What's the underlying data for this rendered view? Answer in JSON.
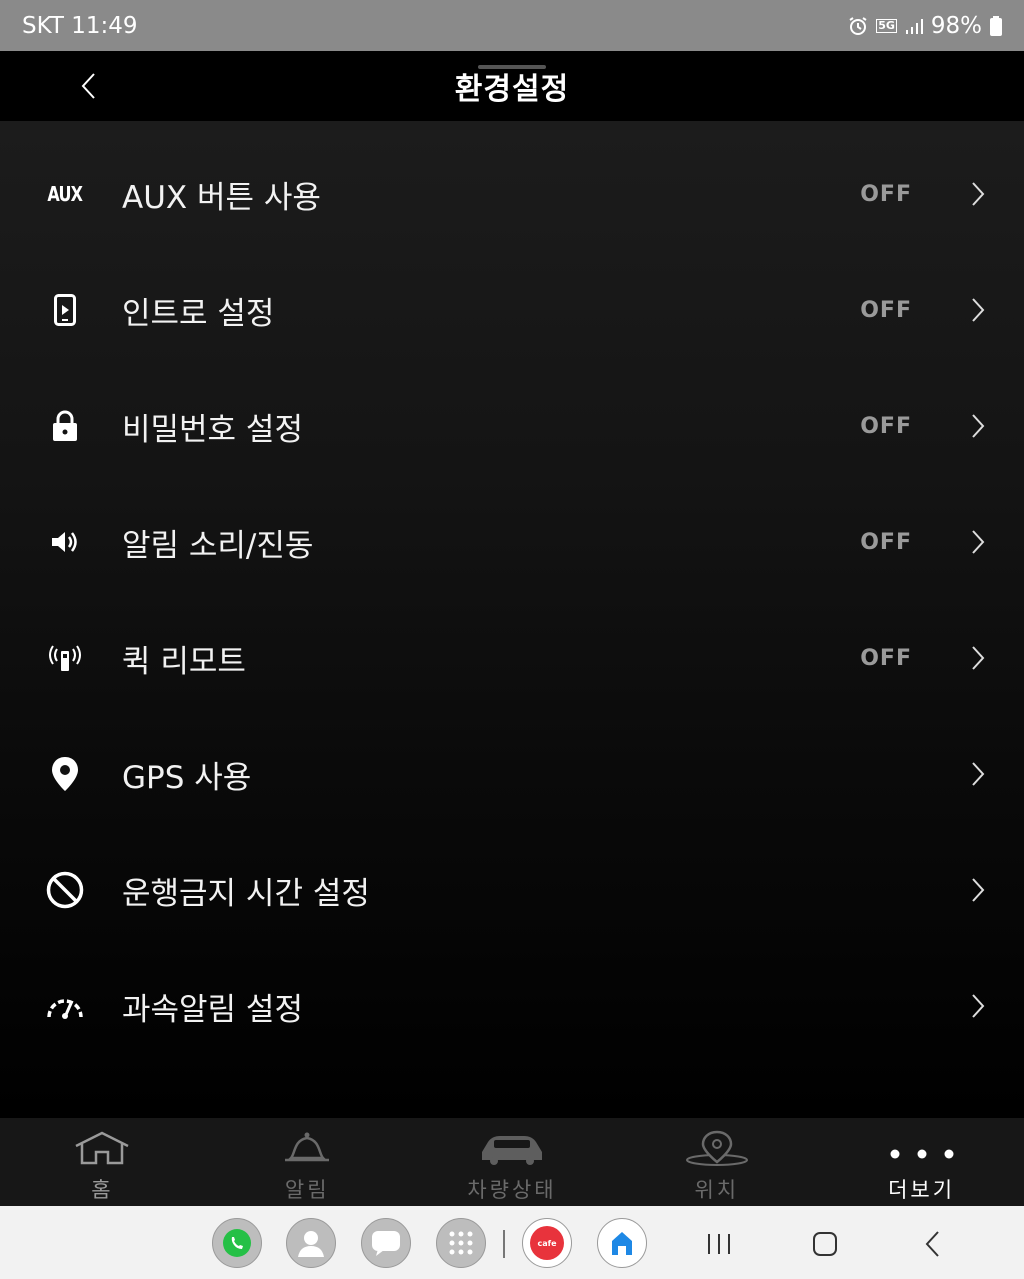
{
  "status_bar": {
    "carrier_time": "SKT 11:49",
    "network": "5G",
    "battery": "98%"
  },
  "header": {
    "title": "환경설정"
  },
  "settings": [
    {
      "icon": "aux-icon",
      "icon_text": "AUX",
      "label": "AUX 버튼 사용",
      "value": "OFF"
    },
    {
      "icon": "phone-intro-icon",
      "label": "인트로 설정",
      "value": "OFF"
    },
    {
      "icon": "lock-icon",
      "label": "비밀번호 설정",
      "value": "OFF"
    },
    {
      "icon": "speaker-icon",
      "label": "알림 소리/진동",
      "value": "OFF"
    },
    {
      "icon": "remote-signal-icon",
      "label": "퀵 리모트",
      "value": "OFF"
    },
    {
      "icon": "location-pin-icon",
      "label": "GPS 사용",
      "value": ""
    },
    {
      "icon": "prohibited-icon",
      "label": "운행금지 시간 설정",
      "value": ""
    },
    {
      "icon": "speedometer-icon",
      "label": "과속알림 설정",
      "value": ""
    }
  ],
  "tabs": [
    {
      "icon": "home-icon",
      "label": "홈",
      "active": false
    },
    {
      "icon": "bell-icon",
      "label": "알림",
      "active": false
    },
    {
      "icon": "car-icon",
      "label": "차량상태",
      "active": false
    },
    {
      "icon": "map-pin-icon",
      "label": "위치",
      "active": false
    },
    {
      "icon": "more-icon",
      "label": "더보기",
      "active": true
    }
  ],
  "colors": {
    "active_tab": "#ffffff",
    "inactive_tab": "#6a6a6a",
    "value_text": "#9a9a9a"
  },
  "dock_apps": [
    "whatsapp-icon",
    "contacts-icon",
    "messages-icon",
    "app-drawer-icon",
    "cafe-icon",
    "home-app-icon"
  ],
  "dock_texts": {
    "cafe": "cafe"
  }
}
